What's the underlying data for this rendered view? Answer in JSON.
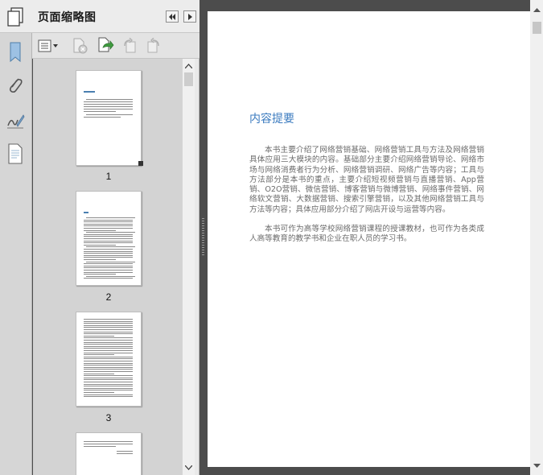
{
  "panel": {
    "title": "页面缩略图"
  },
  "icons": {
    "panel_icon": "pages-icon",
    "rail": [
      "bookmark-icon",
      "attachment-icon",
      "signature-icon",
      "page-thumbnails-icon"
    ],
    "header": [
      "collapse-panel-icon",
      "expand-panel-icon"
    ],
    "toolbar": [
      "options-menu-icon",
      "delete-page-icon",
      "insert-page-icon",
      "rotate-left-icon",
      "rotate-right-icon"
    ]
  },
  "thumbnails": [
    {
      "label": "1"
    },
    {
      "label": "2"
    },
    {
      "label": "3"
    }
  ],
  "document": {
    "title": "内容提要",
    "paragraphs": [
      "本书主要介绍了网络营销基础、网络营销工具与方法及网络营销具体应用三大模块的内容。基础部分主要介绍网络营销导论、网络市场与网络消费者行为分析、网络营销调研、网络广告等内容；工具与方法部分是本书的重点，主要介绍短视频营销与直播营销、App营销、O2O营销、微信营销、博客营销与微博营销、网络事件营销、网络软文营销、大数据营销、搜索引擎营销，以及其他网络营销工具与方法等内容；具体应用部分介绍了网店开设与运营等内容。",
      "本书可作为高等学校网络营销课程的授课教材，也可作为各类成人高等教育的教学书和企业在职人员的学习书。"
    ]
  },
  "colors": {
    "title_blue": "#3b7bbf",
    "body_gray": "#6b6b6b",
    "backdrop": "#4c4c4c"
  }
}
